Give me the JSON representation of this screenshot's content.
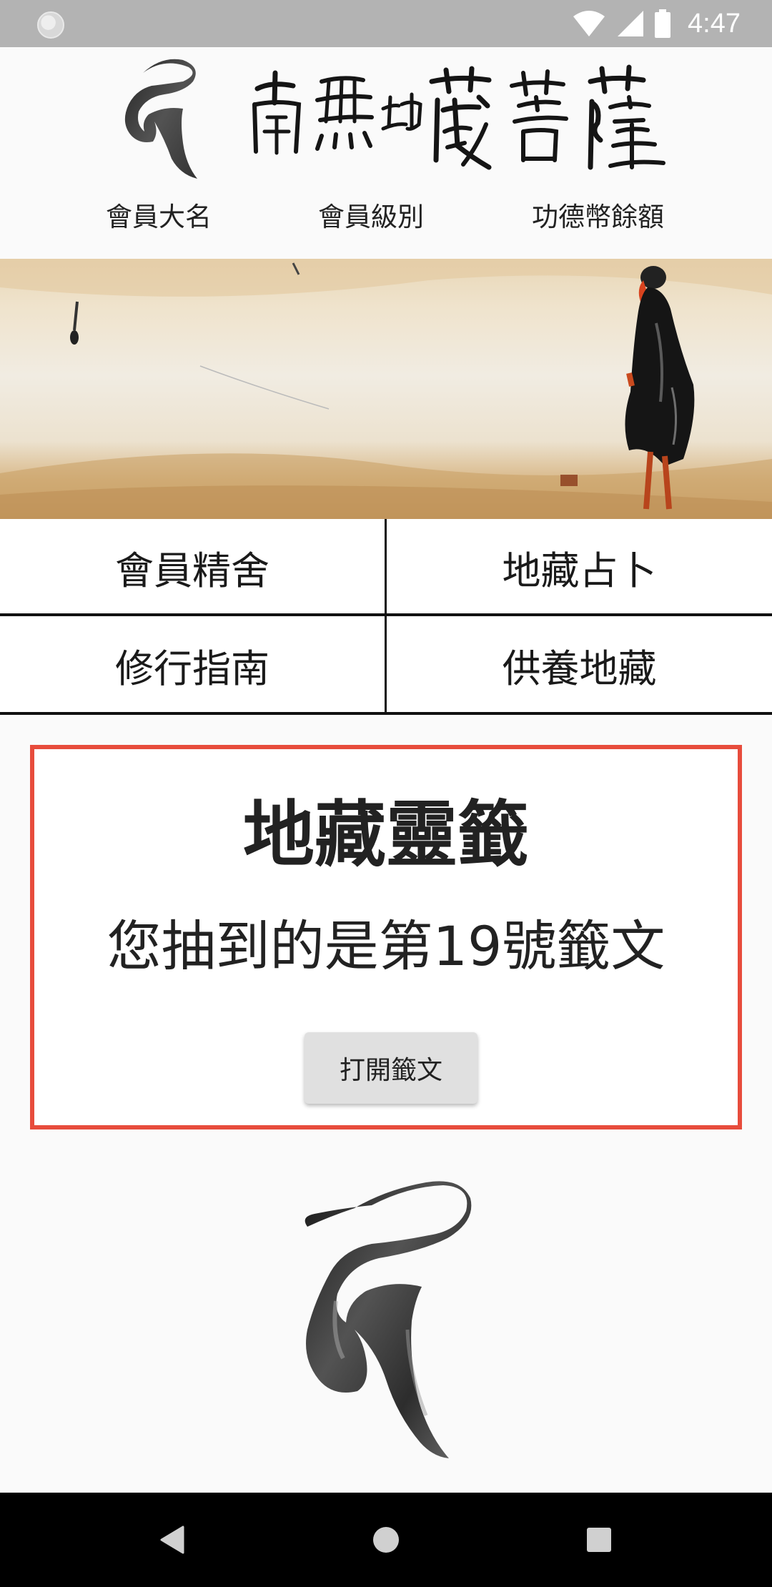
{
  "status_bar": {
    "time": "4:47",
    "icons": [
      "notification-dot-icon",
      "wifi-icon",
      "cellular-signal-icon",
      "battery-icon"
    ]
  },
  "header": {
    "logo_icon": "ksitigarbha-seed-syllable-icon",
    "calligraphy_text": "南無地藏菩薩",
    "member_fields": {
      "name_label": "會員大名",
      "level_label": "會員級別",
      "balance_label": "功德幣餘額"
    }
  },
  "banner": {
    "image": "ink-painting-monk-walking"
  },
  "menu": {
    "items": [
      {
        "label": "會員精舍"
      },
      {
        "label": "地藏占卜"
      },
      {
        "label": "修行指南"
      },
      {
        "label": "供養地藏"
      }
    ]
  },
  "fortune": {
    "title": "地藏靈籤",
    "message": "您抽到的是第19號籤文",
    "open_button_label": "打開籤文",
    "border_color": "#e74c3c"
  },
  "footer": {
    "logo_icon": "ksitigarbha-seed-syllable-icon"
  },
  "nav_bar": {
    "back_icon": "back-triangle-icon",
    "home_icon": "home-circle-icon",
    "recents_icon": "recents-square-icon"
  }
}
